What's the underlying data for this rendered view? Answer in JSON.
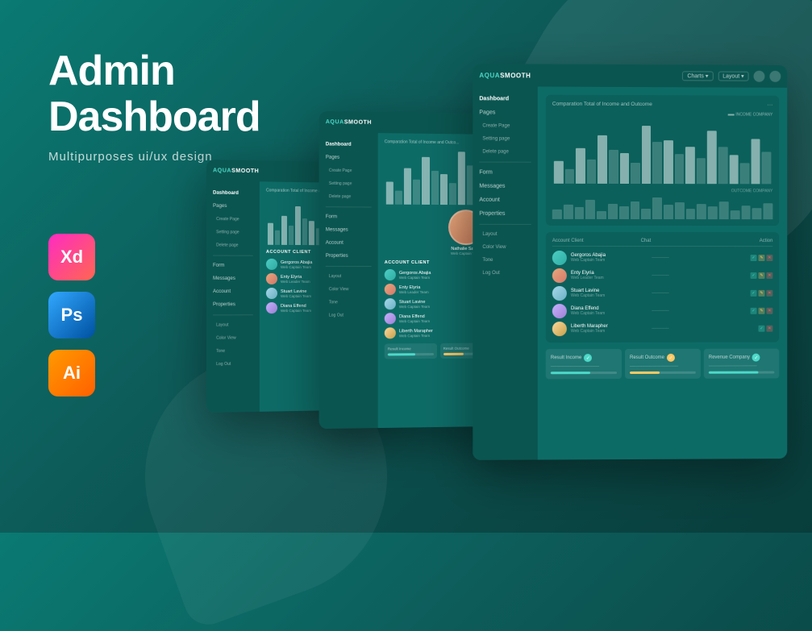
{
  "hero": {
    "title_line1": "Admin",
    "title_line2": "Dashboard",
    "subtitle": "Multipurposes ui/ux design"
  },
  "tools": [
    {
      "label": "Xd",
      "class": "tool-xd",
      "name": "adobe-xd"
    },
    {
      "label": "Ps",
      "class": "tool-ps",
      "name": "adobe-ps"
    },
    {
      "label": "Ai",
      "class": "tool-ai",
      "name": "adobe-ai"
    }
  ],
  "mockup": {
    "logo": "AQUASMOOTH",
    "nav_items": [
      "Dashboard",
      "Pages",
      "Form",
      "Messages",
      "Account",
      "Properties"
    ],
    "sub_items": [
      "Create Page",
      "Setting page",
      "Delete page"
    ],
    "layout_items": [
      "Layout",
      "Color View",
      "Tone",
      "Log Out"
    ],
    "chart_title": "Comparation Total of Income and Outcome",
    "account_client_title": "Account Client",
    "clients": [
      {
        "name": "Gergoros Abajia",
        "role": "Web Captain Team"
      },
      {
        "name": "Enty Elyria",
        "role": "Web Leader Team"
      },
      {
        "name": "Stuart Lavine",
        "role": "Web Captain Team"
      },
      {
        "name": "Diana Effend",
        "role": "Web Captain Team"
      },
      {
        "name": "Liberth Marapher",
        "role": "Web Captain Team"
      }
    ],
    "result_cards": [
      {
        "label": "Result Income",
        "fill": 60
      },
      {
        "label": "Result Outcome",
        "fill": 45
      },
      {
        "label": "Revenue Company",
        "fill": 75
      }
    ],
    "bars_light": [
      30,
      50,
      40,
      70,
      55,
      65,
      45,
      80,
      60,
      75,
      50,
      90,
      65,
      55,
      45,
      70,
      60,
      80,
      50,
      65
    ],
    "bars_dark": [
      20,
      35,
      30,
      45,
      40,
      50,
      35,
      55,
      40,
      50,
      35,
      60,
      45,
      40,
      35,
      50,
      45,
      55,
      38,
      48
    ]
  }
}
